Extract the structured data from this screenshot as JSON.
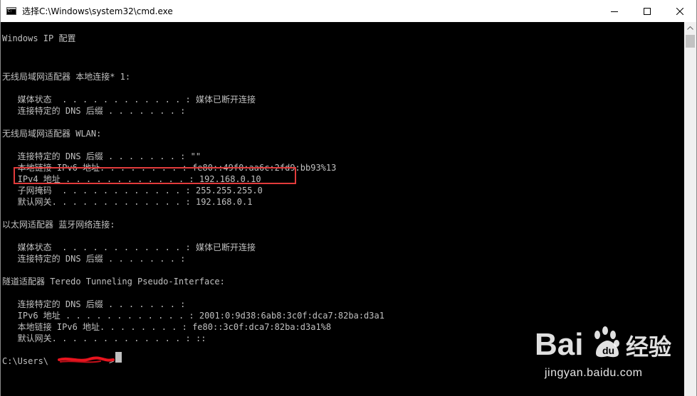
{
  "window": {
    "title": "选择C:\\Windows\\system32\\cmd.exe"
  },
  "console": {
    "lines": [
      "Windows IP 配置",
      "",
      "",
      "无线局域网适配器 本地连接* 1:",
      "",
      "   媒体状态  . . . . . . . . . . . . : 媒体已断开连接",
      "   连接特定的 DNS 后缀 . . . . . . . :",
      "",
      "无线局域网适配器 WLAN:",
      "",
      "   连接特定的 DNS 后缀 . . . . . . . : \"\"",
      "   本地链接 IPv6 地址. . . . . . . . : fe80::49f0:aa6c:2fd9:bb93%13",
      "   IPv4 地址 . . . . . . . . . . . . : 192.168.0.10",
      "   子网掩码  . . . . . . . . . . . . : 255.255.255.0",
      "   默认网关. . . . . . . . . . . . . : 192.168.0.1",
      "",
      "以太网适配器 蓝牙网络连接:",
      "",
      "   媒体状态  . . . . . . . . . . . . : 媒体已断开连接",
      "   连接特定的 DNS 后缀 . . . . . . . :",
      "",
      "隧道适配器 Teredo Tunneling Pseudo-Interface:",
      "",
      "   连接特定的 DNS 后缀 . . . . . . . :",
      "   IPv6 地址 . . . . . . . . . . . . : 2001:0:9d38:6ab8:3c0f:dca7:82ba:d3a1",
      "   本地链接 IPv6 地址. . . . . . . . : fe80::3c0f:dca7:82ba:d3a1%8",
      "   默认网关. . . . . . . . . . . . . : ::",
      "",
      "C:\\Users\\"
    ],
    "prompt_end": ">"
  },
  "annotation": {
    "highlight_color": "#e23b3b"
  },
  "watermark": {
    "brand": "Bai",
    "brand_tail": "经验",
    "url": "jingyan.baidu.com"
  },
  "icons": {
    "app": "console-icon",
    "minimize": "minimize-icon",
    "maximize": "maximize-icon",
    "close": "close-icon",
    "scroll_up": "chevron-up-icon"
  }
}
